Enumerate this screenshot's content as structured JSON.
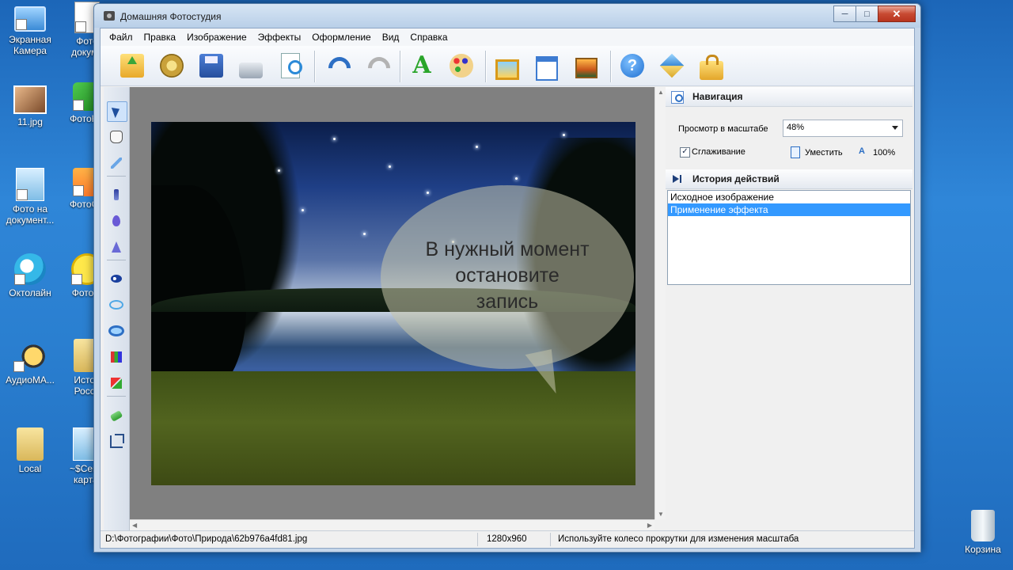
{
  "desktop": {
    "icons": [
      {
        "label": "Экранная\nКамера"
      },
      {
        "label": "Фото\nдокуме"
      },
      {
        "label": "11.jpg"
      },
      {
        "label": "ФотоКО"
      },
      {
        "label": "Фото на\nдокумент..."
      },
      {
        "label": "ФотоСА"
      },
      {
        "label": "Октолайн"
      },
      {
        "label": "ФотоШ"
      },
      {
        "label": "АудиоМА..."
      },
      {
        "label": "Истор\nРосси"
      },
      {
        "label": "Local"
      },
      {
        "label": "~$Сема\nкарта."
      },
      {
        "label": "Корзина"
      }
    ]
  },
  "window": {
    "title": "Домашняя Фотостудия",
    "controls": {
      "minimize": "─",
      "maximize": "□",
      "close": "✕"
    }
  },
  "menu": [
    "Файл",
    "Правка",
    "Изображение",
    "Эффекты",
    "Оформление",
    "Вид",
    "Справка"
  ],
  "toolbar": {
    "buttons": [
      "open-icon",
      "film-icon",
      "save-icon",
      "print-icon",
      "preview-icon",
      "undo-icon",
      "redo-icon",
      "text-icon",
      "palette-icon",
      "frame-icon",
      "calendar-icon",
      "picture-icon",
      "help-icon",
      "box-icon",
      "bag-icon"
    ],
    "text_glyph": "A",
    "help_glyph": "?"
  },
  "tools": [
    "arrow-icon",
    "hand-icon",
    "wand-icon",
    "brush-icon",
    "drop-icon",
    "cone-icon",
    "eye-icon",
    "eye-outline-icon",
    "eye-blue-icon",
    "rgb-icon",
    "swap-icon",
    "eraser-icon",
    "crop-icon"
  ],
  "canvas": {
    "bubble_text": "В нужный момент\nостановите\nзапись"
  },
  "navigation": {
    "title": "Навигация",
    "zoom_label": "Просмотр в масштабе",
    "zoom_value": "48%",
    "smoothing_label": "Сглаживание",
    "smoothing_checked": true,
    "check_mark": "✓",
    "fit_label": "Уместить",
    "hundred_label": "100%",
    "hundred_glyph": "A"
  },
  "history": {
    "title": "История действий",
    "items": [
      "Исходное изображение",
      "Применение эффекта"
    ],
    "selected_index": 1
  },
  "status": {
    "path": "D:\\Фотографии\\Фото\\Природа\\62b976a4fd81.jpg",
    "size": "1280x960",
    "hint": "Используйте колесо прокрутки для изменения масштаба"
  },
  "colors": {
    "selection": "#3399ff",
    "accent": "#2d6fc4"
  }
}
